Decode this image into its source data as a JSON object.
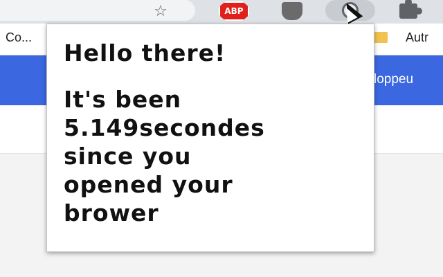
{
  "toolbar": {
    "icons": [
      "star-icon",
      "abp-icon",
      "shield-icon",
      "extension-icon",
      "puzzle-icon"
    ],
    "abp_label": "ABP"
  },
  "bookmarks": {
    "left_item": "Co...",
    "right_item": "Autr"
  },
  "page": {
    "band_text": "loppeu",
    "band_color": "#3b68e0"
  },
  "popup": {
    "title": "Hello there!",
    "line1": "It's been",
    "line2": "5.149secondes",
    "line3": "since you",
    "line4": "opened your",
    "line5": "brower"
  }
}
